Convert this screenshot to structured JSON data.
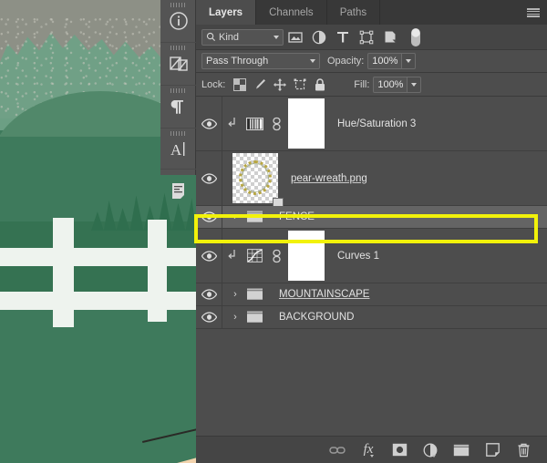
{
  "tabs": [
    {
      "label": "Layers",
      "active": true
    },
    {
      "label": "Channels",
      "active": false
    },
    {
      "label": "Paths",
      "active": false
    }
  ],
  "panel_menu_icon": "hamburger-menu-icon",
  "filter": {
    "kind_label": "Kind",
    "search_icon": "search-icon",
    "icons": [
      "pixel-layer-filter-icon",
      "adjustment-layer-filter-icon",
      "type-layer-filter-icon",
      "shape-layer-filter-icon",
      "smart-object-filter-icon"
    ],
    "toggle_icon": "filter-toggle-switch"
  },
  "blend": {
    "mode": "Pass Through",
    "opacity_label": "Opacity:",
    "opacity_value": "100%"
  },
  "lock": {
    "label": "Lock:",
    "icons": [
      "lock-transparency-icon",
      "lock-image-pixels-icon",
      "lock-position-icon",
      "lock-artboard-icon",
      "lock-all-icon"
    ],
    "fill_label": "Fill:",
    "fill_value": "100%"
  },
  "layers": [
    {
      "name": "Hue/Saturation 3",
      "type": "adjustment",
      "visible": true,
      "clipped": true,
      "linked": true,
      "underlined": false,
      "selected": false,
      "adj_icon": "hue-saturation-icon",
      "mask_color": "#ffffff"
    },
    {
      "name": "pear-wreath.png",
      "type": "smart-object",
      "visible": true,
      "clipped": false,
      "linked": false,
      "underlined": true,
      "selected": false,
      "thumb": "wreath-thumbnail",
      "badge": "smart-object-badge"
    },
    {
      "name": "FENCE",
      "type": "group",
      "visible": true,
      "underlined": false,
      "selected": true,
      "folder_icon": "folder-icon",
      "chevron": "chevron-right-icon"
    },
    {
      "name": "Curves 1",
      "type": "adjustment",
      "visible": true,
      "clipped": true,
      "linked": true,
      "underlined": false,
      "selected": false,
      "adj_icon": "curves-icon",
      "mask_color": "#ffffff"
    },
    {
      "name": "MOUNTAINSCAPE",
      "type": "group",
      "visible": true,
      "underlined": true,
      "selected": false,
      "folder_icon": "folder-icon",
      "chevron": "chevron-right-icon"
    },
    {
      "name": "BACKGROUND",
      "type": "group",
      "visible": true,
      "underlined": false,
      "selected": false,
      "folder_icon": "folder-icon",
      "chevron": "chevron-right-icon"
    }
  ],
  "bottom_toolbar": [
    "link-layers-icon",
    "layer-style-fx-icon",
    "add-layer-mask-icon",
    "new-adjustment-layer-icon",
    "new-group-icon",
    "new-layer-icon",
    "delete-layer-icon"
  ],
  "bottom_toolbar_fx_label": "fx",
  "toolrail": [
    "info-panel-icon",
    "layer-comps-icon",
    "paragraph-icon",
    "character-icon",
    "paragraph-styles-icon"
  ],
  "highlight": {
    "color": "#f2f20a",
    "target_layer": "FENCE"
  },
  "canvas": {
    "description": "mountain-landscape-with-white-fence-illustration",
    "colors": {
      "sky": "#8d9086",
      "trees": "#6fa186",
      "hill": "#51886a",
      "grass": "#3e7a5c",
      "grass_dark": "#357252",
      "fence": "#eef3ee",
      "tan": "#f2d3ad"
    }
  }
}
